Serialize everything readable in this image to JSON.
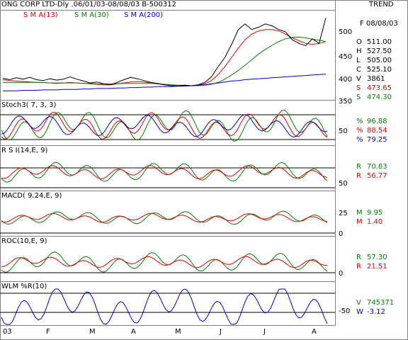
{
  "header": {
    "title": "ONG CORP LTD-Dly .06/01/03-08/08/03  B-500312",
    "mode": "TREND"
  },
  "price_panel": {
    "sma13_label": "S M A(13)",
    "sma30_label": "S M A(30)",
    "sma200_label": "S M A(200)",
    "date_label": "F 08/08/03",
    "values": [
      {
        "k": "O",
        "v": "511.00",
        "color": "#000000"
      },
      {
        "k": "H",
        "v": "527.50",
        "color": "#000000"
      },
      {
        "k": "L",
        "v": "505.00",
        "color": "#000000"
      },
      {
        "k": "C",
        "v": "525.10",
        "color": "#000000"
      },
      {
        "k": "V",
        "v": "3861",
        "color": "#000000"
      },
      {
        "k": "S",
        "v": "473.65",
        "color": "#e00000"
      },
      {
        "k": "S",
        "v": "474.30",
        "color": "#008000"
      }
    ],
    "ticks": [
      "500",
      "450",
      "400",
      "350"
    ]
  },
  "stoch_panel": {
    "label": "Stoch3( 7, 3, 3)",
    "values": [
      {
        "k": "%",
        "v": "96.88",
        "color": "#008000"
      },
      {
        "k": "%",
        "v": "88.54",
        "color": "#e00000"
      },
      {
        "k": "%",
        "v": "79.25",
        "color": "#0000c0"
      }
    ],
    "ticks": [
      "50"
    ]
  },
  "rsi_panel": {
    "label": "R S I(14,E, 9)",
    "values": [
      {
        "k": "R",
        "v": "70.83",
        "color": "#008000"
      },
      {
        "k": "R",
        "v": "56.77",
        "color": "#e00000"
      }
    ],
    "ticks": [
      "50"
    ]
  },
  "macd_panel": {
    "label": "MACD( 9,24,E, 9)",
    "values": [
      {
        "k": "M",
        "v": "9.95",
        "color": "#008000"
      },
      {
        "k": "M",
        "v": "1.40",
        "color": "#e00000"
      }
    ],
    "ticks": [
      "25",
      "0"
    ]
  },
  "roc_panel": {
    "label": "ROC(10,E, 9)",
    "values": [
      {
        "k": "R",
        "v": "57.30",
        "color": "#008000"
      },
      {
        "k": "R",
        "v": "21.51",
        "color": "#e00000"
      }
    ],
    "ticks": [
      "0"
    ]
  },
  "wlm_panel": {
    "label": "WLM %R(10)",
    "values": [
      {
        "k": "V",
        "v": "745371",
        "color": "#008000"
      },
      {
        "k": "W",
        "v": "-3.12",
        "color": "#0000c0"
      }
    ],
    "ticks": [
      "-50"
    ]
  },
  "xaxis": {
    "labels": [
      "03",
      "F",
      "M",
      "A",
      "M",
      "J",
      "J",
      "A"
    ]
  },
  "chart_data": {
    "type": "line",
    "series": [
      {
        "name": "S M A(13)",
        "values": [
          392,
          390,
          389,
          388,
          387,
          386,
          386,
          385,
          384,
          385,
          386,
          385,
          384,
          383,
          382,
          381,
          381,
          383,
          385,
          387,
          388,
          387,
          385,
          383,
          381,
          380,
          379,
          379,
          379,
          380,
          383,
          390,
          403,
          420,
          440,
          460,
          478,
          490,
          497,
          500,
          500,
          497,
          490,
          482,
          476,
          470,
          468,
          470,
          474
        ],
        "color": "#e00000"
      },
      {
        "name": "S M A(30)",
        "values": [
          386,
          386,
          386,
          386,
          386,
          386,
          386,
          385,
          385,
          385,
          385,
          385,
          384,
          384,
          383,
          383,
          383,
          383,
          384,
          384,
          384,
          384,
          384,
          383,
          382,
          381,
          380,
          380,
          379,
          379,
          380,
          382,
          386,
          393,
          402,
          412,
          423,
          435,
          447,
          457,
          466,
          474,
          480,
          483,
          484,
          482,
          479,
          477,
          474
        ],
        "color": "#008000"
      },
      {
        "name": "S M A(200)",
        "values": [
          368,
          368,
          368,
          369,
          369,
          369,
          370,
          370,
          370,
          371,
          371,
          371,
          372,
          372,
          373,
          373,
          373,
          374,
          374,
          375,
          375,
          376,
          376,
          377,
          377,
          377,
          378,
          378,
          379,
          380,
          381,
          383,
          385,
          387,
          389,
          390,
          392,
          393,
          394,
          395,
          396,
          397,
          398,
          399,
          400,
          401,
          402,
          403,
          404
        ],
        "color": "#0000c0"
      },
      {
        "name": "Close",
        "values": [
          395,
          392,
          396,
          393,
          397,
          392,
          390,
          394,
          391,
          393,
          398,
          393,
          389,
          385,
          387,
          383,
          381,
          386,
          392,
          397,
          394,
          390,
          386,
          384,
          381,
          379,
          378,
          380,
          379,
          381,
          386,
          398,
          420,
          440,
          468,
          500,
          512,
          500,
          505,
          512,
          508,
          500,
          495,
          478,
          470,
          465,
          480,
          470,
          525
        ],
        "color": "#000000"
      }
    ],
    "ylim": [
      350,
      530
    ]
  }
}
